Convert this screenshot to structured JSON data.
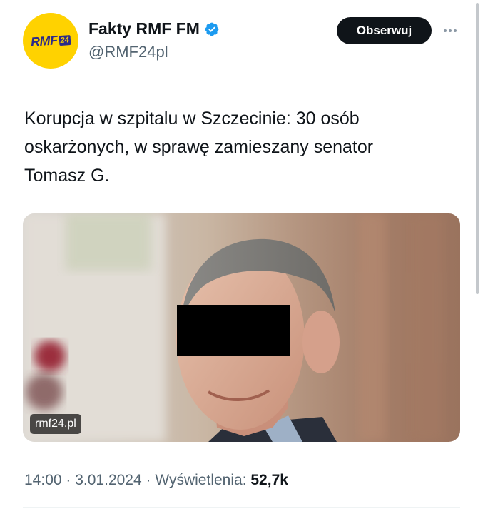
{
  "author": {
    "display_name": "Fakty RMF FM",
    "handle": "@RMF24pl",
    "verified": true,
    "avatar_logo_text": "RMF",
    "avatar_logo_number": "24",
    "avatar_color": "#ffd200",
    "avatar_logo_color": "#2d2a88"
  },
  "actions": {
    "follow_label": "Obserwuj",
    "more_icon": "more-horizontal-icon"
  },
  "tweet": {
    "text_lines": [
      "Korupcja w szpitalu w Szczecinie: 30 osób",
      "oskarżonych, w sprawę zamieszany senator",
      "Tomasz G."
    ]
  },
  "media": {
    "source_badge": "rmf24.pl",
    "description_icon": "photo-icon"
  },
  "meta": {
    "time": "14:00",
    "separator": " · ",
    "date": "3.01.2024",
    "views_label": "Wyświetlenia:",
    "views_count": "52,7k"
  },
  "colors": {
    "text_primary": "#0f1419",
    "text_secondary": "#536471",
    "verified_blue": "#1d9bf0",
    "button_bg": "#0f1419"
  }
}
